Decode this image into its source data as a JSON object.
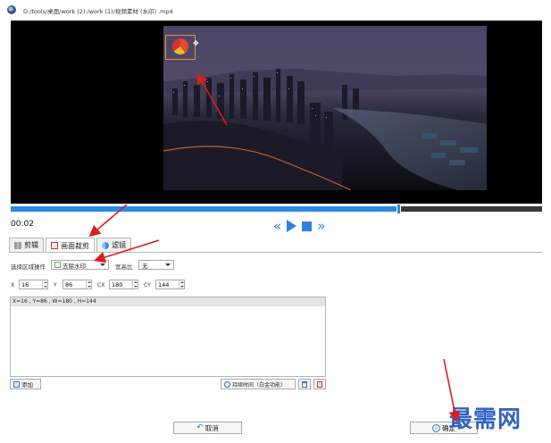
{
  "window": {
    "title": "D:/tools/桌面/work (2) /work (1)/视频素材 (水印) .mp4"
  },
  "player": {
    "current_time": "00:02",
    "progress_fraction": 0.73,
    "controls": [
      "rewind-icon",
      "play-icon",
      "stop-icon",
      "fast-forward-icon"
    ]
  },
  "tabs": [
    {
      "label": "剪辑",
      "icon": "cut-icon",
      "active": false
    },
    {
      "label": "画面裁剪",
      "icon": "crop-icon",
      "active": true
    },
    {
      "label": "滤镜",
      "icon": "filter-icon",
      "active": false
    }
  ],
  "selection": {
    "op_label": "选择区域操作",
    "op_value": "去除水印",
    "ratio_label": "宽高比",
    "ratio_value": "无"
  },
  "coords": {
    "x_label": "X",
    "x_value": "16",
    "y_label": "Y",
    "y_value": "86",
    "w_label": "CX",
    "w_value": "180",
    "h_label": "CY",
    "h_value": "144"
  },
  "region_list": {
    "items": [
      "X=16 , Y=86 , W=180 , H=144"
    ]
  },
  "buttons": {
    "add": "添加",
    "duration": "持续时间（白金功能）",
    "cancel": "取消",
    "ok": "确定"
  },
  "brand": {
    "watermark": "最需网"
  },
  "colors": {
    "accent": "#2f7fe0",
    "annotation": "#d81e1e",
    "crop_border": "#e8942a"
  }
}
